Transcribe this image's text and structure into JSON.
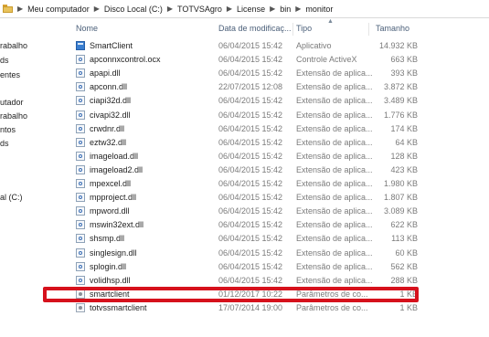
{
  "breadcrumb": [
    "Meu computador",
    "Disco Local (C:)",
    "TOTVSAgro",
    "License",
    "bin",
    "monitor"
  ],
  "nav_pane": [
    "rabalho",
    "ds",
    "entes",
    "utador",
    "rabalho",
    "ntos",
    "ds",
    "al (C:)"
  ],
  "columns": {
    "name": "Nome",
    "date": "Data de modificaç...",
    "type": "Tipo",
    "size": "Tamanho"
  },
  "files": [
    {
      "name": "SmartClient",
      "date": "06/04/2015 15:42",
      "type": "Aplicativo",
      "size": "14.932 KB",
      "icon": "app-icon"
    },
    {
      "name": "apconnxcontrol.ocx",
      "date": "06/04/2015 15:42",
      "type": "Controle ActiveX",
      "size": "663 KB",
      "icon": "dll-icon"
    },
    {
      "name": "apapi.dll",
      "date": "06/04/2015 15:42",
      "type": "Extensão de aplica...",
      "size": "393 KB",
      "icon": "dll-icon"
    },
    {
      "name": "apconn.dll",
      "date": "22/07/2015 12:08",
      "type": "Extensão de aplica...",
      "size": "3.872 KB",
      "icon": "dll-icon"
    },
    {
      "name": "ciapi32d.dll",
      "date": "06/04/2015 15:42",
      "type": "Extensão de aplica...",
      "size": "3.489 KB",
      "icon": "dll-icon"
    },
    {
      "name": "civapi32.dll",
      "date": "06/04/2015 15:42",
      "type": "Extensão de aplica...",
      "size": "1.776 KB",
      "icon": "dll-icon"
    },
    {
      "name": "crwdnr.dll",
      "date": "06/04/2015 15:42",
      "type": "Extensão de aplica...",
      "size": "174 KB",
      "icon": "dll-icon"
    },
    {
      "name": "eztw32.dll",
      "date": "06/04/2015 15:42",
      "type": "Extensão de aplica...",
      "size": "64 KB",
      "icon": "dll-icon"
    },
    {
      "name": "imageload.dll",
      "date": "06/04/2015 15:42",
      "type": "Extensão de aplica...",
      "size": "128 KB",
      "icon": "dll-icon"
    },
    {
      "name": "imageload2.dll",
      "date": "06/04/2015 15:42",
      "type": "Extensão de aplica...",
      "size": "423 KB",
      "icon": "dll-icon"
    },
    {
      "name": "mpexcel.dll",
      "date": "06/04/2015 15:42",
      "type": "Extensão de aplica...",
      "size": "1.980 KB",
      "icon": "dll-icon"
    },
    {
      "name": "mpproject.dll",
      "date": "06/04/2015 15:42",
      "type": "Extensão de aplica...",
      "size": "1.807 KB",
      "icon": "dll-icon"
    },
    {
      "name": "mpword.dll",
      "date": "06/04/2015 15:42",
      "type": "Extensão de aplica...",
      "size": "3.089 KB",
      "icon": "dll-icon"
    },
    {
      "name": "mswin32ext.dll",
      "date": "06/04/2015 15:42",
      "type": "Extensão de aplica...",
      "size": "622 KB",
      "icon": "dll-icon"
    },
    {
      "name": "shsmp.dll",
      "date": "06/04/2015 15:42",
      "type": "Extensão de aplica...",
      "size": "113 KB",
      "icon": "dll-icon"
    },
    {
      "name": "singlesign.dll",
      "date": "06/04/2015 15:42",
      "type": "Extensão de aplica...",
      "size": "60 KB",
      "icon": "dll-icon"
    },
    {
      "name": "splogin.dll",
      "date": "06/04/2015 15:42",
      "type": "Extensão de aplica...",
      "size": "562 KB",
      "icon": "dll-icon"
    },
    {
      "name": "volidhsp.dll",
      "date": "06/04/2015 15:42",
      "type": "Extensão de aplica...",
      "size": "288 KB",
      "icon": "dll-icon"
    },
    {
      "name": "smartclient",
      "date": "01/12/2017 10:22",
      "type": "Parâmetros de co...",
      "size": "1 KB",
      "icon": "settings-file-icon"
    },
    {
      "name": "totvssmartclient",
      "date": "17/07/2014 19:00",
      "type": "Parâmetros de co...",
      "size": "1 KB",
      "icon": "settings-file-icon"
    }
  ],
  "colors": {
    "highlight": "#d6111c",
    "header_text": "#4c607a",
    "meta_text": "#7b7b7b"
  }
}
